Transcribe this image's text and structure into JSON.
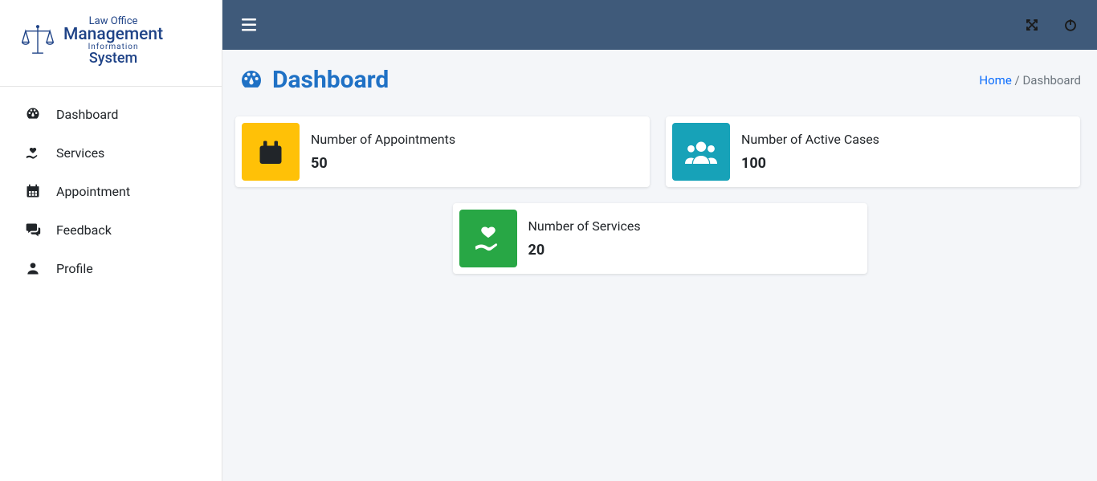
{
  "logo": {
    "line1": "Law Office",
    "line2": "Management",
    "line3": "Information",
    "line4": "System"
  },
  "sidebar": {
    "items": [
      {
        "label": "Dashboard",
        "icon": "gauge"
      },
      {
        "label": "Services",
        "icon": "hand-heart"
      },
      {
        "label": "Appointment",
        "icon": "calendar"
      },
      {
        "label": "Feedback",
        "icon": "comments"
      },
      {
        "label": "Profile",
        "icon": "user"
      }
    ]
  },
  "header": {
    "title": "Dashboard",
    "breadcrumb_home": "Home",
    "breadcrumb_current": "Dashboard"
  },
  "cards": [
    {
      "title": "Number of Appointments",
      "value": "50",
      "icon": "calendar",
      "color": "#ffc107"
    },
    {
      "title": "Number of Active Cases",
      "value": "100",
      "icon": "users",
      "color": "#17a2b8"
    },
    {
      "title": "Number of Services",
      "value": "20",
      "icon": "hand-heart",
      "color": "#28a745"
    }
  ]
}
